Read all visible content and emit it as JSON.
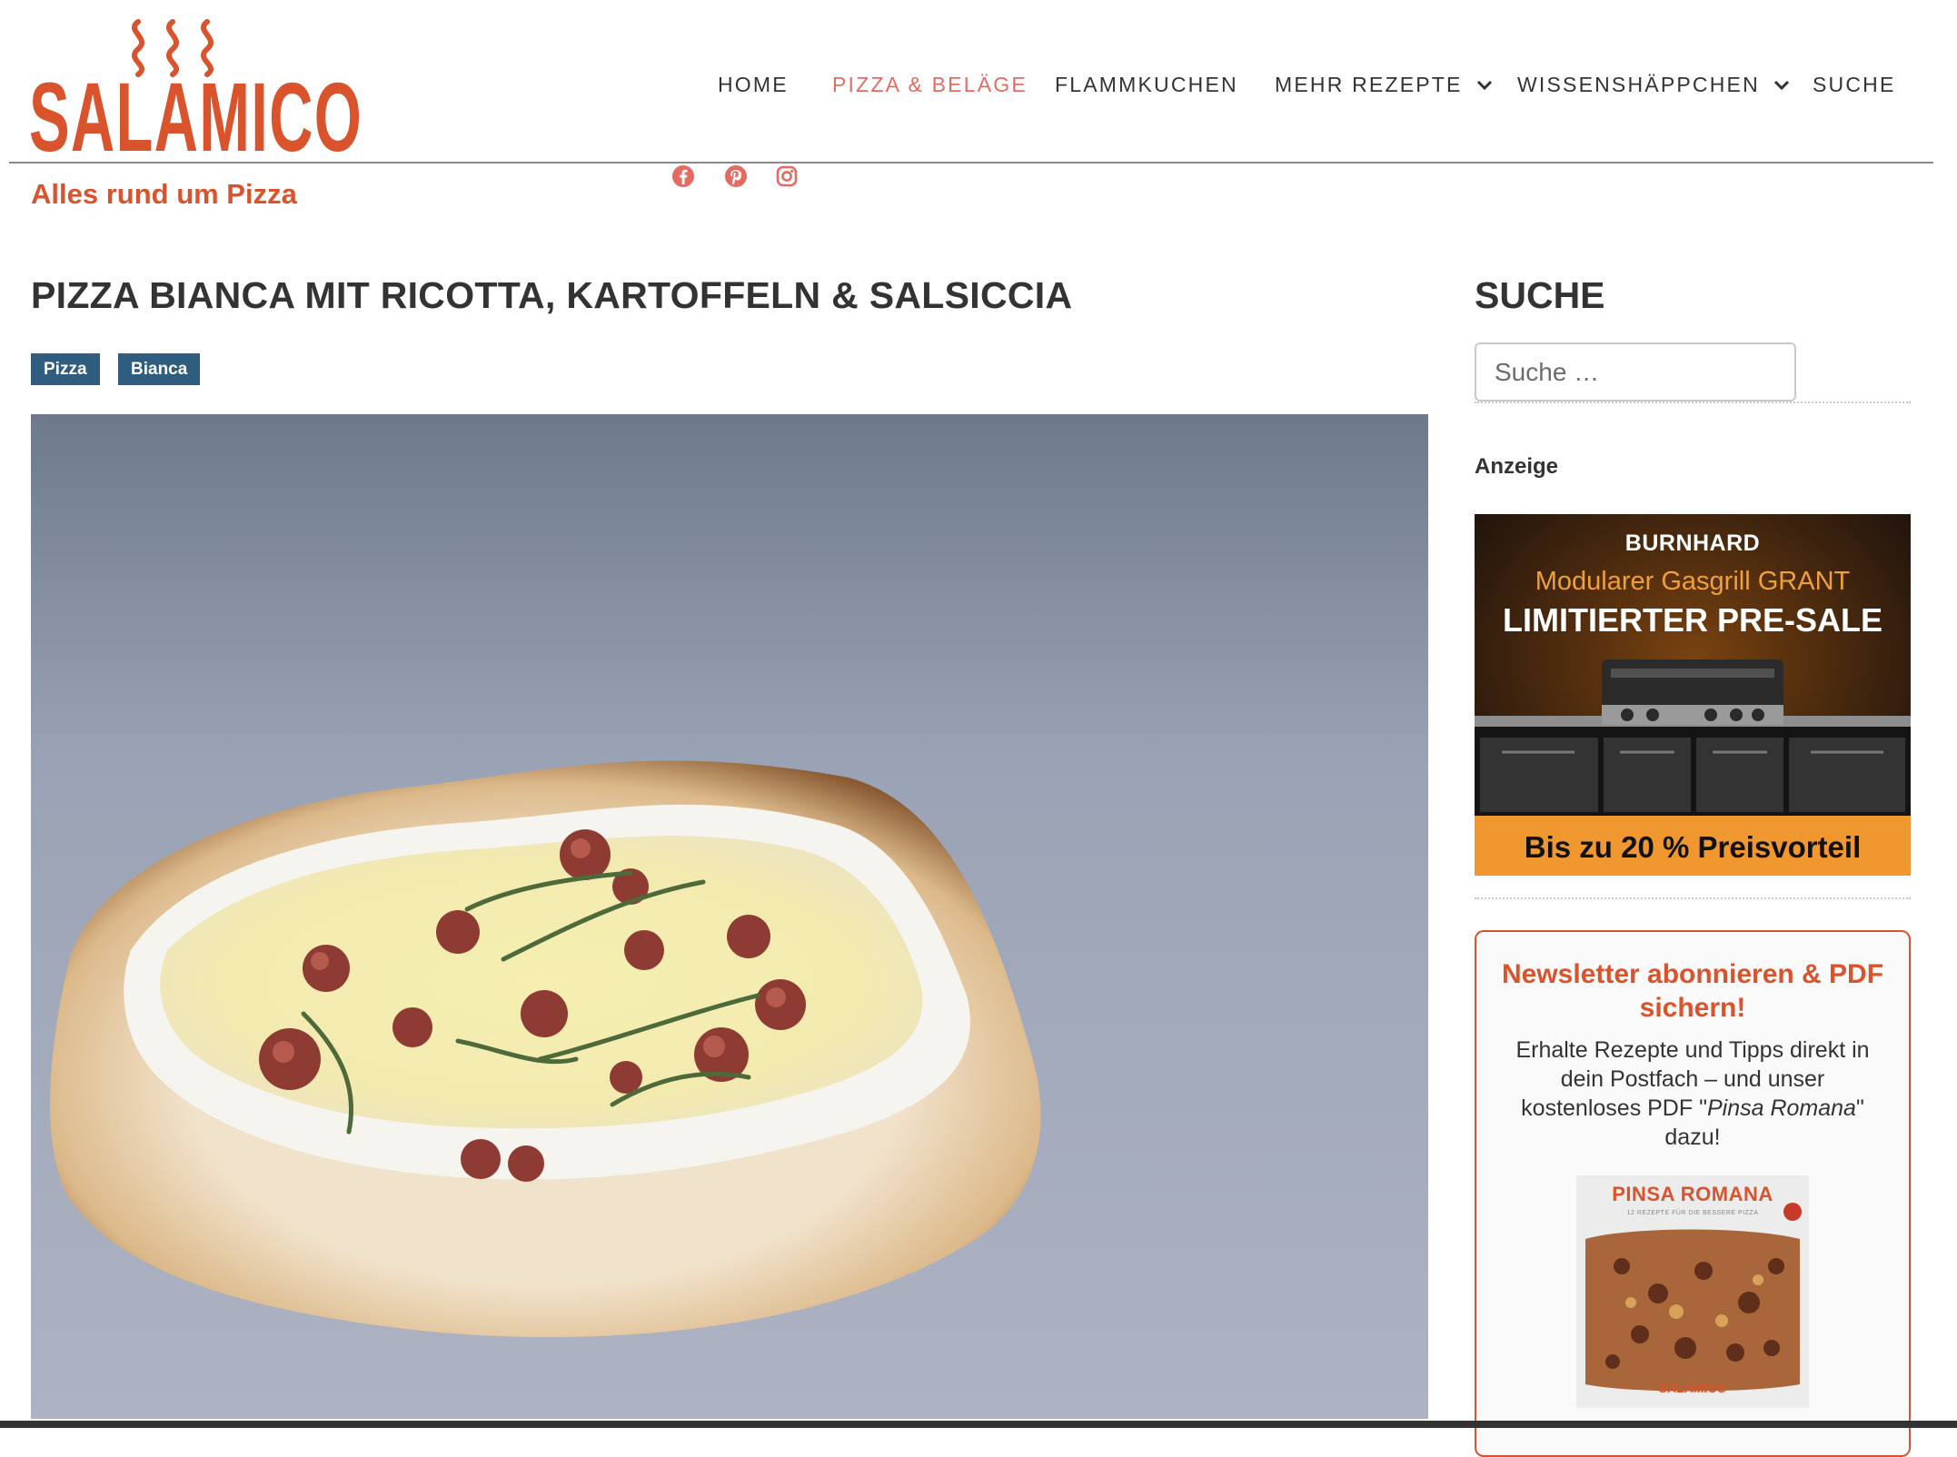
{
  "brand": {
    "name": "SALAMICO",
    "tagline": "Alles rund um Pizza",
    "color": "#d9532d"
  },
  "nav": {
    "items": [
      {
        "label": "HOME"
      },
      {
        "label": "PIZZA & BELÄGE",
        "active": true
      },
      {
        "label": "FLAMMKUCHEN"
      },
      {
        "label": "MEHR REZEPTE",
        "dropdown": true
      },
      {
        "label": "WISSENSHÄPPCHEN",
        "dropdown": true
      },
      {
        "label": "SUCHE"
      }
    ]
  },
  "social": [
    "facebook-icon",
    "pinterest-icon",
    "instagram-icon"
  ],
  "post": {
    "title": "PIZZA BIANCA MIT RICOTTA, KARTOFFELN & SALSICCIA",
    "tags": [
      "Pizza",
      "Bianca"
    ]
  },
  "sidebar": {
    "search_title": "SUCHE",
    "search_placeholder": "Suche …",
    "ad_label": "Anzeige",
    "ad": {
      "brand": "BURNHARD",
      "line1": "Modularer Gasgrill GRANT",
      "line2": "LIMITIERTER PRE-SALE",
      "cta": "Bis zu 20 % Preisvorteil"
    },
    "newsletter": {
      "title": "Newsletter abonnieren & PDF sichern!",
      "text_before": "Erhalte Rezepte und Tipps direkt in dein Postfach – und unser kostenloses PDF \"",
      "text_em": "Pinsa Romana",
      "text_after": "\" dazu!",
      "book_title": "PINSA ROMANA",
      "book_subtitle": "12 REZEPTE FÜR DIE BESSERE PIZZA",
      "book_logo": "SALAMICO"
    }
  },
  "colors": {
    "accent": "#d9532d",
    "nav_active": "#e46b61",
    "tag_bg": "#2e5d7f",
    "text": "#333333"
  }
}
